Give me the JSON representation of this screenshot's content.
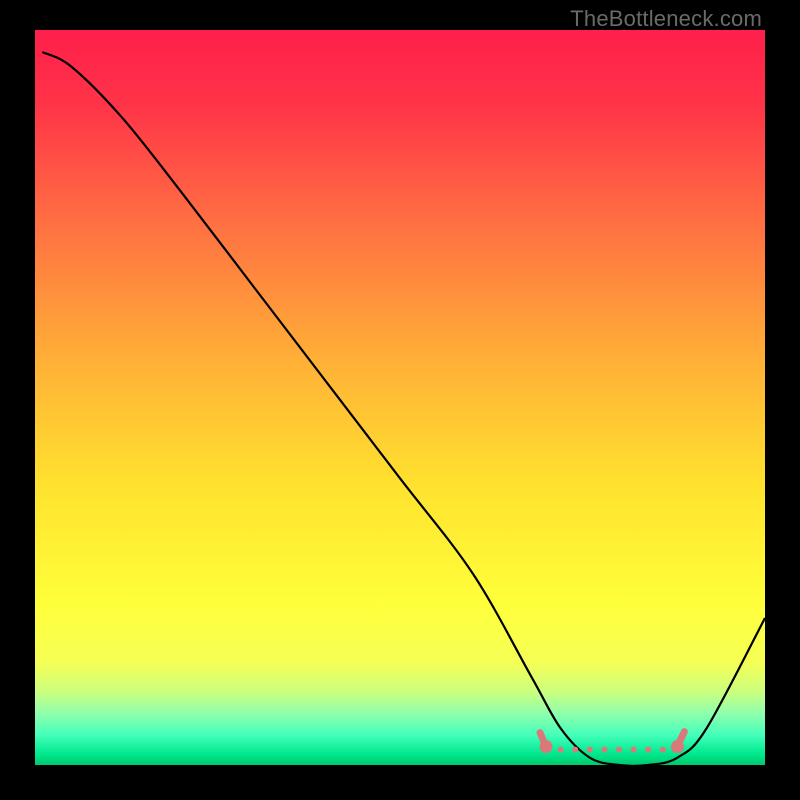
{
  "watermark": "TheBottleneck.com",
  "chart_data": {
    "type": "line",
    "title": "",
    "xlabel": "",
    "ylabel": "",
    "xlim": [
      0,
      100
    ],
    "ylim": [
      0,
      100
    ],
    "series": [
      {
        "name": "bottleneck-curve",
        "x": [
          1,
          5,
          12,
          20,
          30,
          40,
          50,
          60,
          68,
          72,
          76,
          80,
          84,
          88,
          92,
          100
        ],
        "values": [
          97,
          95,
          88,
          78,
          65,
          52,
          39,
          26,
          12,
          5,
          1,
          0,
          0,
          1,
          5,
          20
        ]
      }
    ],
    "gradient_stops": [
      {
        "pos": 0.0,
        "color": "#ff1f4b"
      },
      {
        "pos": 0.1,
        "color": "#ff3348"
      },
      {
        "pos": 0.25,
        "color": "#ff6b43"
      },
      {
        "pos": 0.45,
        "color": "#ffb037"
      },
      {
        "pos": 0.62,
        "color": "#ffe22e"
      },
      {
        "pos": 0.78,
        "color": "#ffff3a"
      },
      {
        "pos": 0.86,
        "color": "#f5ff55"
      },
      {
        "pos": 0.9,
        "color": "#ccff7e"
      },
      {
        "pos": 0.93,
        "color": "#8fffac"
      },
      {
        "pos": 0.96,
        "color": "#42ffba"
      },
      {
        "pos": 0.985,
        "color": "#00e88e"
      },
      {
        "pos": 1.0,
        "color": "#00c86c"
      }
    ],
    "marker_band": {
      "y": 2.5,
      "x_start": 70,
      "x_end": 88,
      "color": "#d97a7a"
    }
  }
}
